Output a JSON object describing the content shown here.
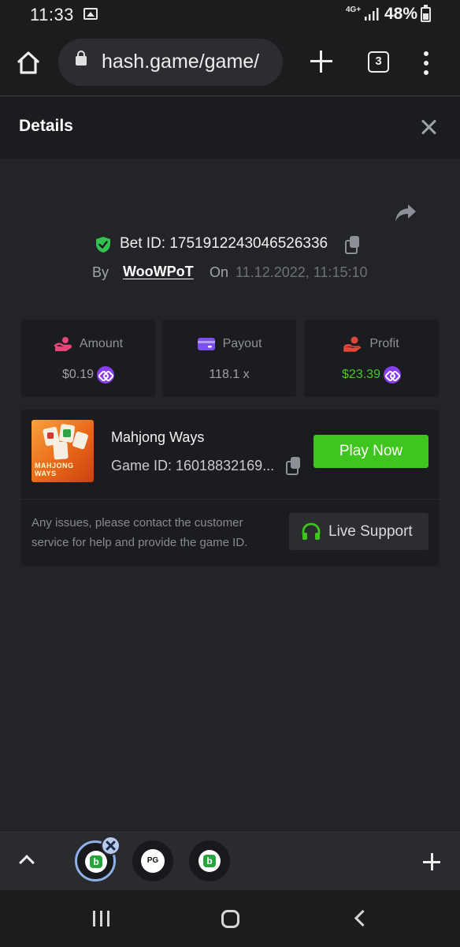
{
  "status_bar": {
    "time": "11:33",
    "network": "4G+",
    "battery": "48%"
  },
  "browser": {
    "url": "hash.game/game/",
    "tab_count": "3"
  },
  "details": {
    "title": "Details",
    "bet_id": "Bet ID: 1751912243046526336",
    "by_label": "By",
    "username": "WooWPoT",
    "on_label": "On",
    "date": "11.12.2022, 11:15:10"
  },
  "stats": {
    "amount": {
      "label": "Amount",
      "value": "$0.19"
    },
    "payout": {
      "label": "Payout",
      "value": "118.1 x"
    },
    "profit": {
      "label": "Profit",
      "value": "$23.39"
    }
  },
  "game": {
    "thumb_text": "MAHJONG WAYS",
    "name": "Mahjong Ways",
    "game_id": "Game ID: 16018832169...",
    "play_label": "Play Now",
    "help_text": "Any issues, please contact the customer service for help and provide the game ID.",
    "support_label": "Live Support"
  },
  "bottom_tabs": {
    "pg_label": "PG"
  },
  "colors": {
    "accent_green": "#3ec51e",
    "profit_green": "#4cc627",
    "coin_purple": "#8a3ef2",
    "amount_pink": "#e8457a",
    "payout_purple": "#7b4ff0",
    "profit_red": "#e0463a",
    "background": "#232428",
    "panel": "#1b1c1f"
  },
  "icons": [
    "home-icon",
    "lock-icon",
    "plus-icon",
    "tabs-icon",
    "more-icon",
    "close-icon",
    "share-icon",
    "shield-check-icon",
    "copy-icon",
    "coin-icon",
    "wallet-icon",
    "headset-icon",
    "chevron-up-icon"
  ]
}
